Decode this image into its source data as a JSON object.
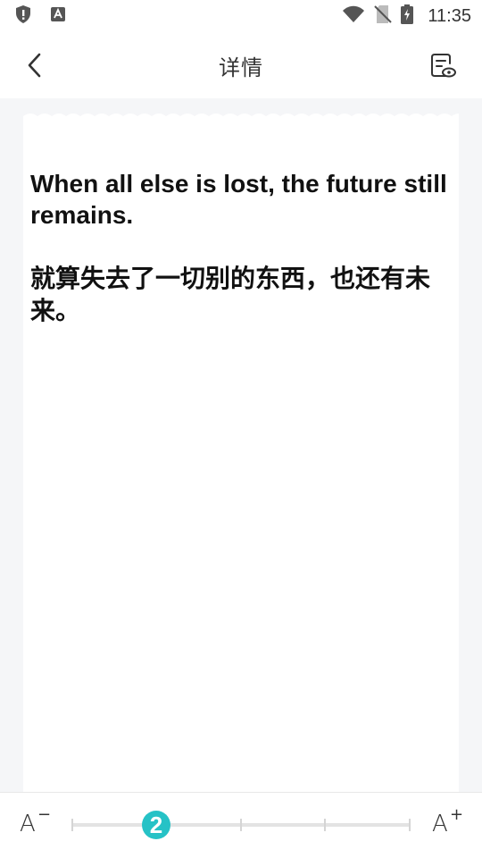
{
  "status_bar": {
    "time": "11:35",
    "icons": [
      "shield-alert-icon",
      "app-notification-icon",
      "wifi-icon",
      "no-sim-icon",
      "battery-charging-icon"
    ]
  },
  "header": {
    "title": "详情",
    "back_icon": "chevron-left-icon",
    "action_icon": "document-preview-icon"
  },
  "content": {
    "quote_en": "When all else is lost, the future still remains.",
    "quote_zh": "就算失去了一切别的东西，也还有未来。"
  },
  "font_size_control": {
    "decrease_label": "A",
    "decrease_mark": "−",
    "increase_label": "A",
    "increase_mark": "+",
    "current_level": "2",
    "levels": 5,
    "accent_color": "#26c2c6"
  }
}
